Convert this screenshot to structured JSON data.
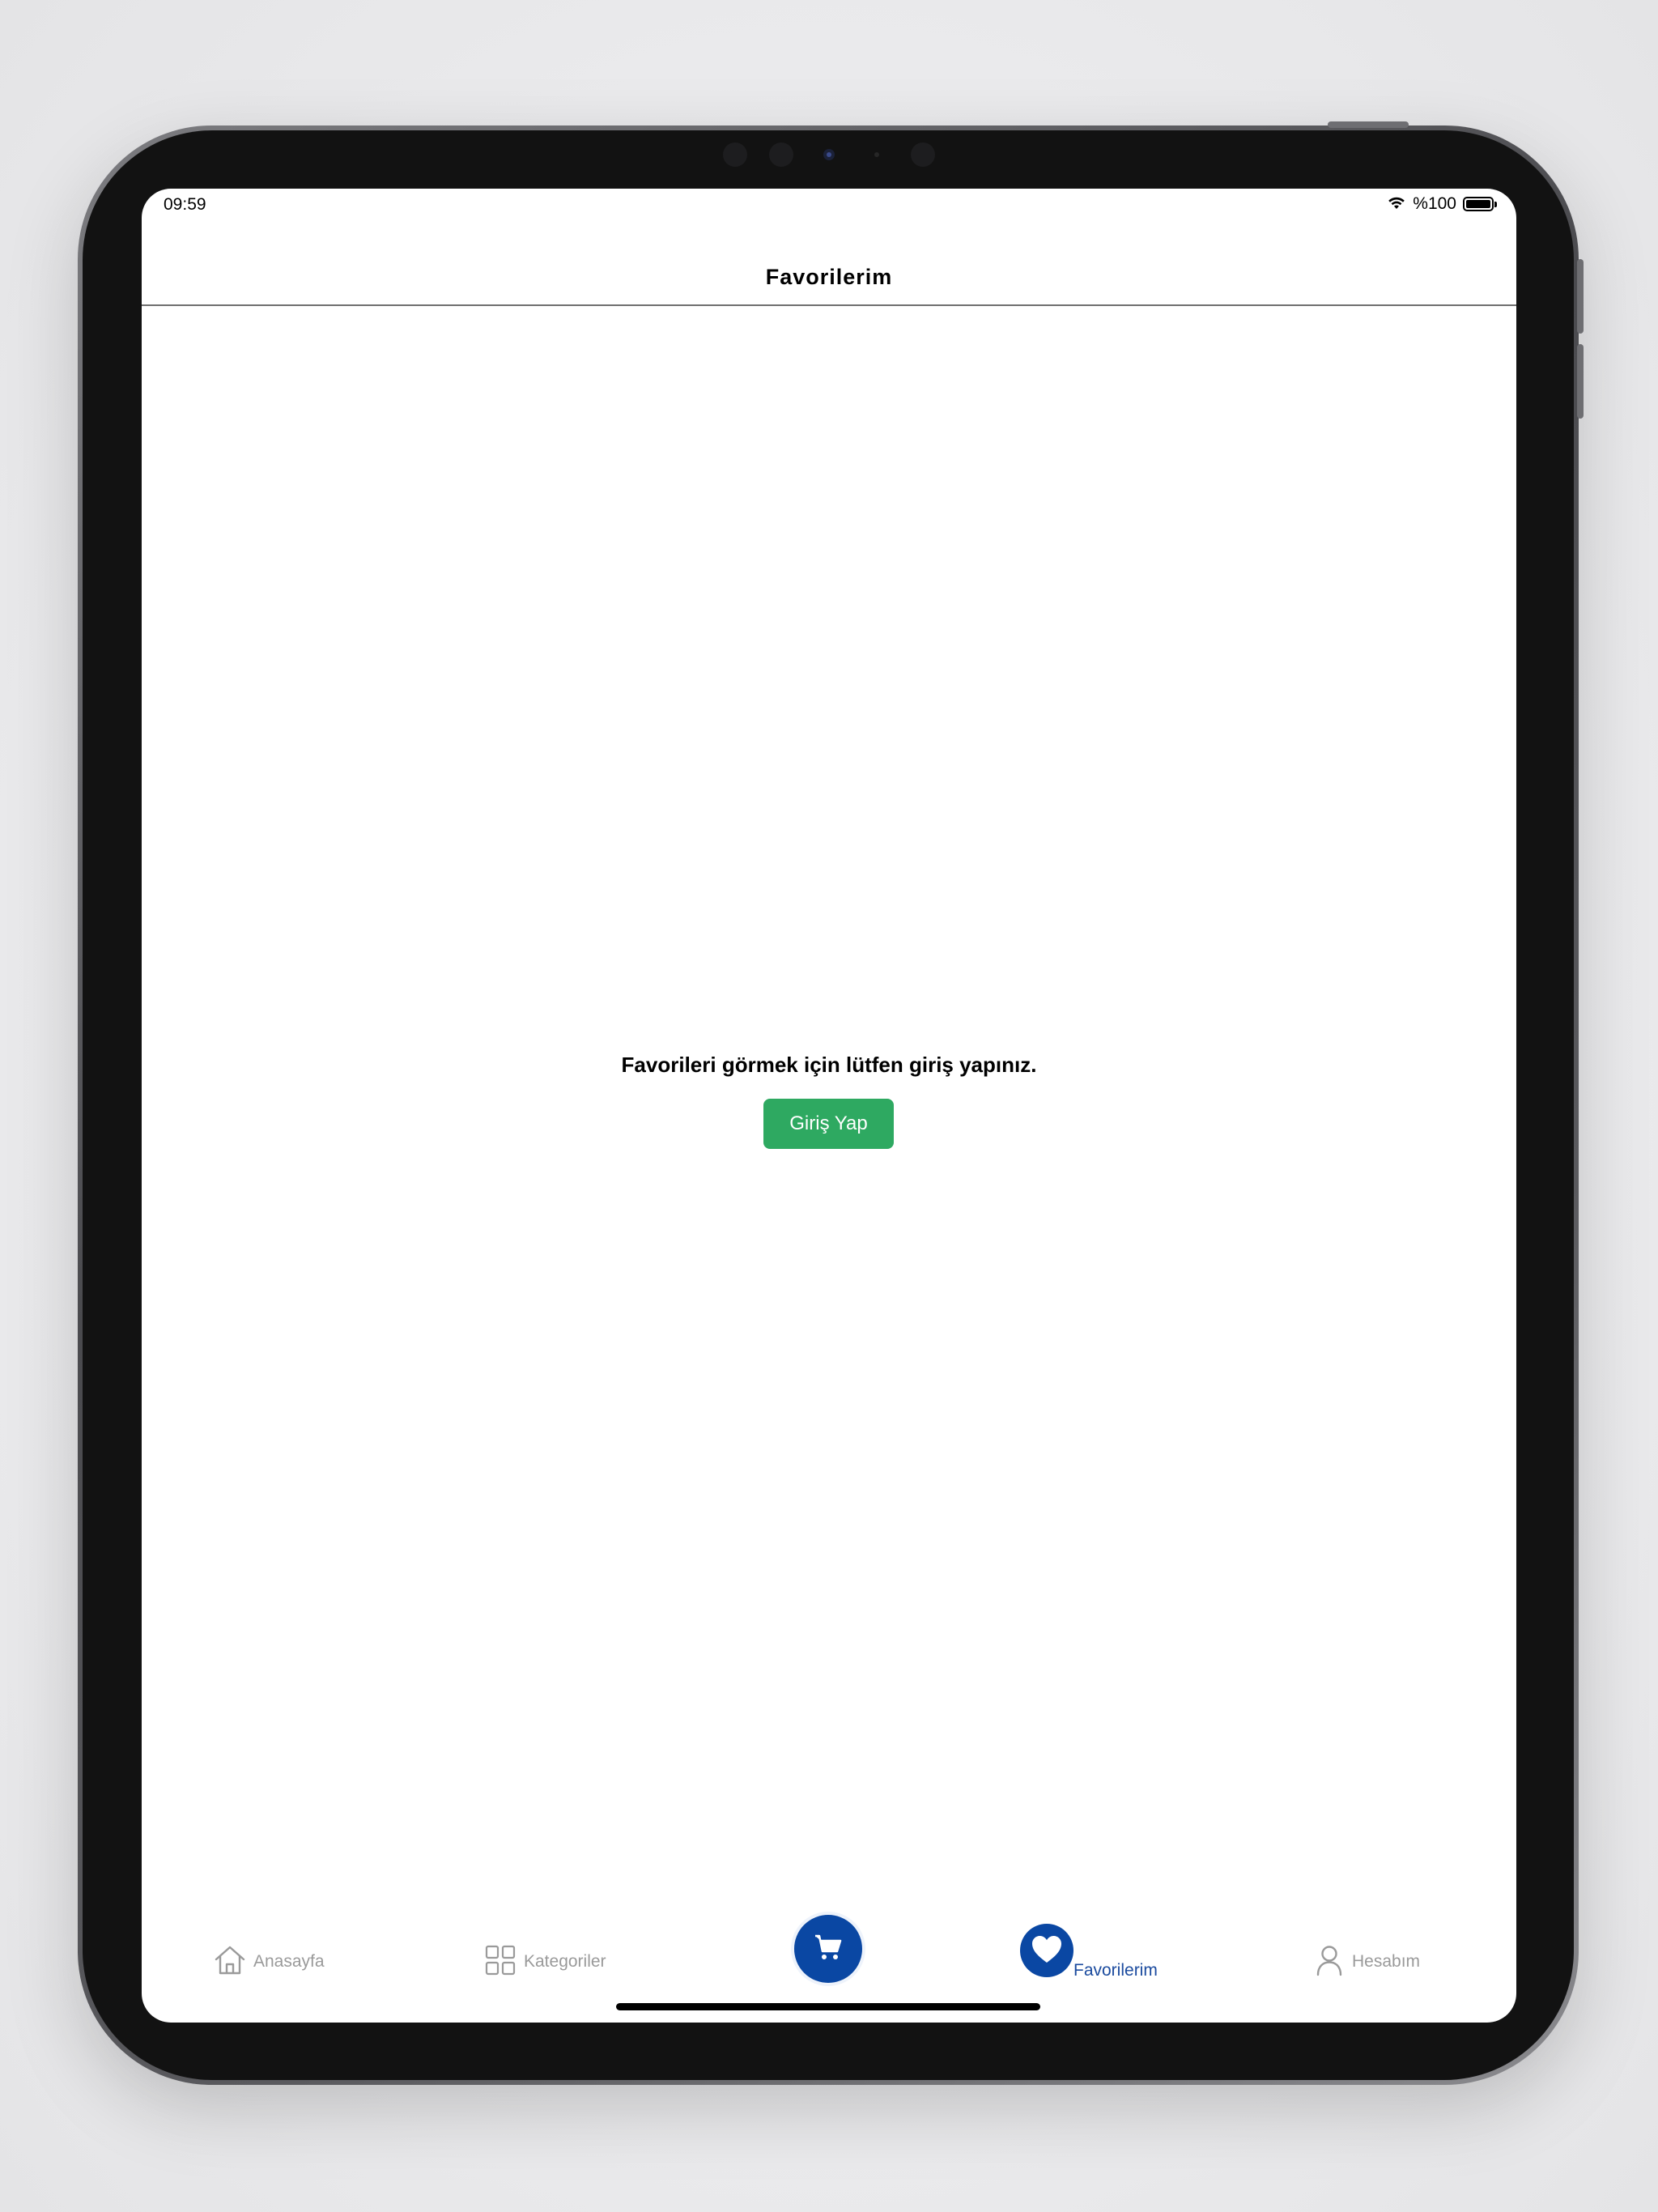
{
  "status_bar": {
    "time": "09:59",
    "battery_text": "%100",
    "icons": [
      "wifi-icon",
      "battery-icon"
    ]
  },
  "header": {
    "title": "Favorilerim"
  },
  "main": {
    "message": "Favorileri görmek için lütfen giriş yapınız.",
    "login_button_label": "Giriş Yap"
  },
  "tab_bar": {
    "items": [
      {
        "label": "Anasayfa",
        "icon": "home-icon",
        "active": false
      },
      {
        "label": "Kategoriler",
        "icon": "grid-icon",
        "active": false
      },
      {
        "label": "",
        "icon": "cart-icon",
        "active": false
      },
      {
        "label": "Favorilerim",
        "icon": "heart-icon",
        "active": true
      },
      {
        "label": "Hesabım",
        "icon": "user-icon",
        "active": false
      }
    ]
  },
  "colors": {
    "accent_blue": "#0a47a3",
    "active_label": "#1a4a9e",
    "login_button": "#2ea961",
    "inactive_label": "#9a9a9a"
  }
}
